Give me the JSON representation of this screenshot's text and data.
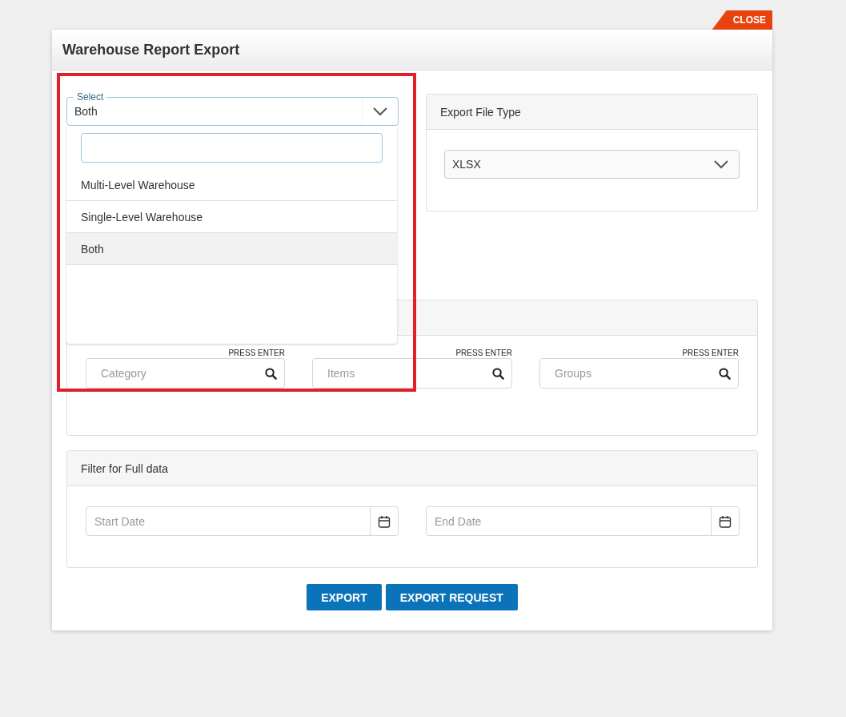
{
  "close_button": "CLOSE",
  "dialog": {
    "title": "Warehouse Report Export"
  },
  "select": {
    "label": "Select",
    "value": "Both",
    "expanded": true,
    "options": [
      {
        "label": "Multi-Level Warehouse",
        "selected": false
      },
      {
        "label": "Single-Level Warehouse",
        "selected": false
      },
      {
        "label": "Both",
        "selected": true
      }
    ]
  },
  "export_file_type": {
    "title": "Export File Type",
    "value": "XLSX"
  },
  "filters": {
    "fields": [
      {
        "hint": "PRESS ENTER",
        "placeholder": "Category"
      },
      {
        "hint": "PRESS ENTER",
        "placeholder": "Items"
      },
      {
        "hint": "PRESS ENTER",
        "placeholder": "Groups"
      }
    ]
  },
  "full_data_filter": {
    "title": "Filter for Full data",
    "fields": [
      {
        "placeholder": "Start Date"
      },
      {
        "placeholder": "End Date"
      }
    ]
  },
  "buttons": [
    "EXPORT",
    "EXPORT REQUEST"
  ]
}
